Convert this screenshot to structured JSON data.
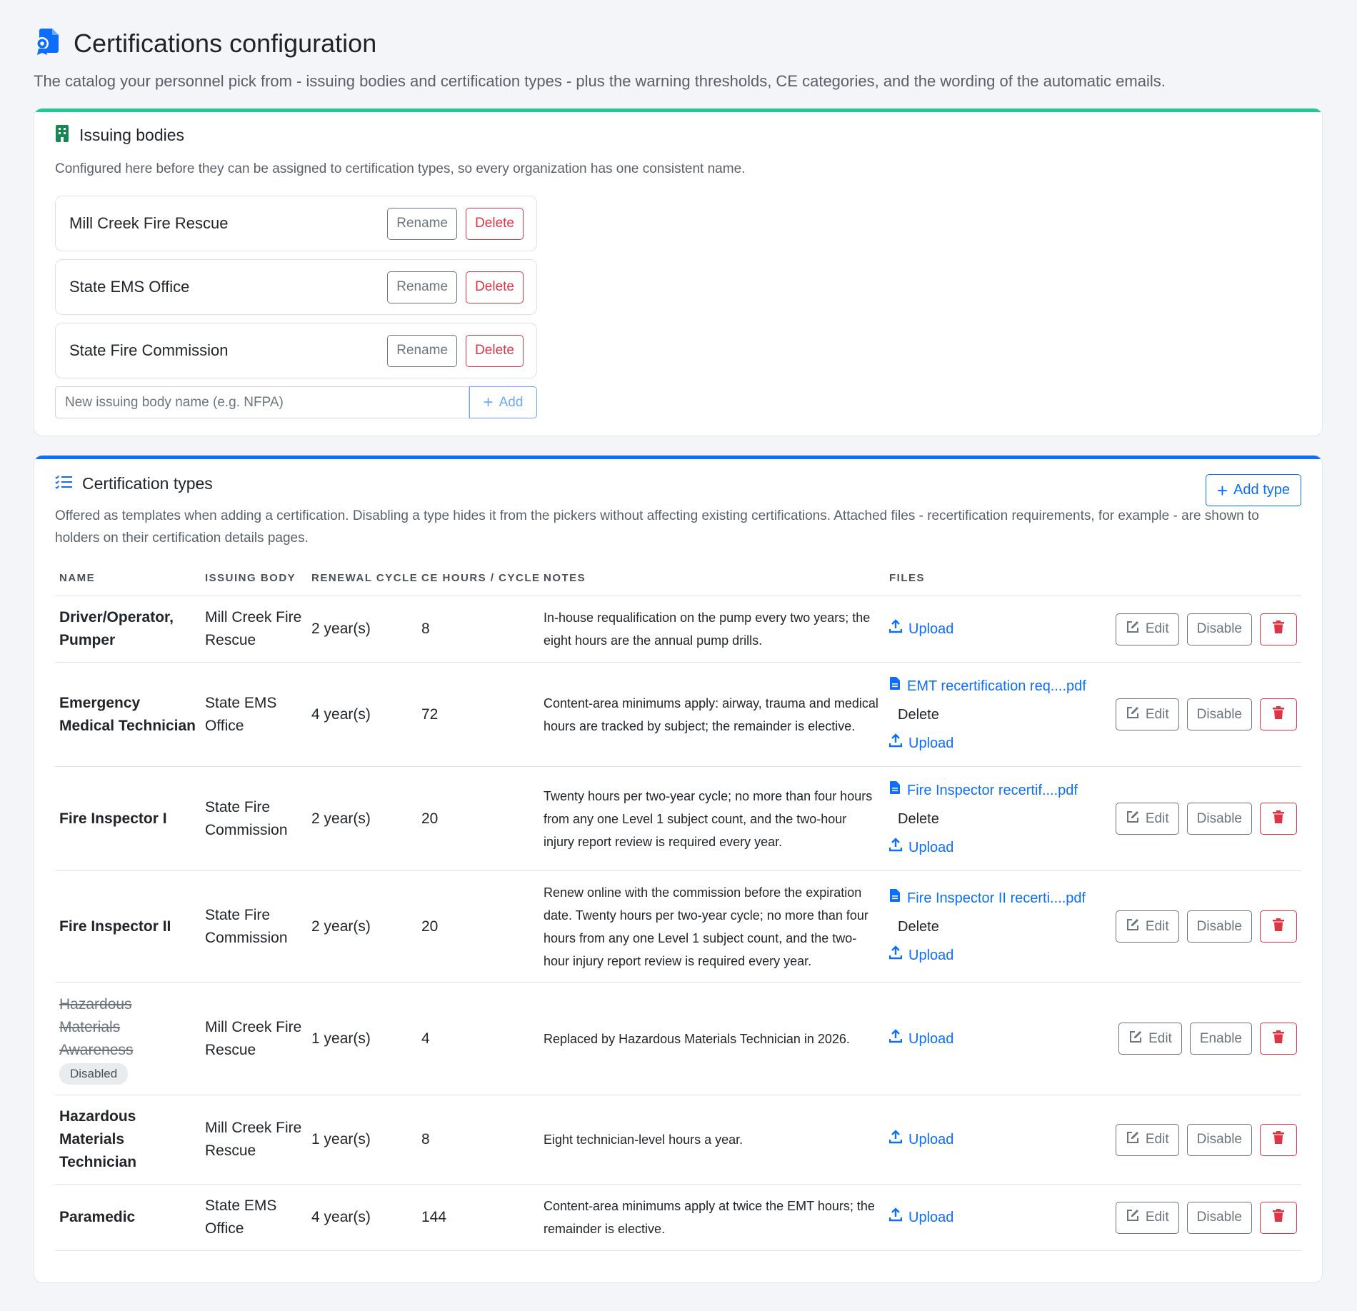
{
  "header": {
    "title": "Certifications configuration",
    "subtitle": "The catalog your personnel pick from - issuing bodies and certification types - plus the warning thresholds, CE categories, and the wording of the automatic emails.",
    "icon": "certificate-icon"
  },
  "colors": {
    "accent_green": "#20c997",
    "accent_blue": "#0d6efd",
    "danger": "#dc3545",
    "secondary": "#6c757d"
  },
  "issuing_bodies": {
    "title": "Issuing bodies",
    "icon": "building-icon",
    "description": "Configured here before they can be assigned to certification types, so every organization has one consistent name.",
    "rename_label": "Rename",
    "delete_label": "Delete",
    "items": [
      {
        "name": "Mill Creek Fire Rescue"
      },
      {
        "name": "State EMS Office"
      },
      {
        "name": "State Fire Commission"
      }
    ],
    "new_input": {
      "value": "",
      "placeholder": "New issuing body name (e.g. NFPA)"
    },
    "add_label": "Add"
  },
  "certification_types": {
    "title": "Certification types",
    "icon": "list-check-icon",
    "add_type_label": "Add type",
    "description": "Offered as templates when adding a certification. Disabling a type hides it from the pickers without affecting existing certifications. Attached files - recertification requirements, for example - are shown to holders on their certification details pages.",
    "columns": [
      "NAME",
      "ISSUING BODY",
      "RENEWAL CYCLE",
      "CE HOURS / CYCLE",
      "NOTES",
      "FILES"
    ],
    "edit_label": "Edit",
    "disable_label": "Disable",
    "enable_label": "Enable",
    "upload_label": "Upload",
    "file_delete_label": "Delete",
    "disabled_badge": "Disabled",
    "rows": [
      {
        "name": "Driver/Operator, Pumper",
        "issuing_body": "Mill Creek Fire Rescue",
        "renewal": "2 year(s)",
        "ce_hours": "8",
        "notes": "In-house requalification on the pump every two years; the eight hours are the annual pump drills.",
        "file": "",
        "disabled": false
      },
      {
        "name": "Emergency Medical Technician",
        "issuing_body": "State EMS Office",
        "renewal": "4 year(s)",
        "ce_hours": "72",
        "notes": "Content-area minimums apply: airway, trauma and medical hours are tracked by subject; the remainder is elective.",
        "file": "EMT recertification req....pdf",
        "disabled": false
      },
      {
        "name": "Fire Inspector I",
        "issuing_body": "State Fire Commission",
        "renewal": "2 year(s)",
        "ce_hours": "20",
        "notes": "Twenty hours per two-year cycle; no more than four hours from any one Level 1 subject count, and the two-hour injury report review is required every year.",
        "file": "Fire Inspector recertif....pdf",
        "disabled": false
      },
      {
        "name": "Fire Inspector II",
        "issuing_body": "State Fire Commission",
        "renewal": "2 year(s)",
        "ce_hours": "20",
        "notes": "Renew online with the commission before the expiration date. Twenty hours per two-year cycle; no more than four hours from any one Level 1 subject count, and the two-hour injury report review is required every year.",
        "file": "Fire Inspector II recerti....pdf",
        "disabled": false
      },
      {
        "name": "Hazardous Materials Awareness",
        "issuing_body": "Mill Creek Fire Rescue",
        "renewal": "1 year(s)",
        "ce_hours": "4",
        "notes": "Replaced by Hazardous Materials Technician in 2026.",
        "file": "",
        "disabled": true
      },
      {
        "name": "Hazardous Materials Technician",
        "issuing_body": "Mill Creek Fire Rescue",
        "renewal": "1 year(s)",
        "ce_hours": "8",
        "notes": "Eight technician-level hours a year.",
        "file": "",
        "disabled": false
      },
      {
        "name": "Paramedic",
        "issuing_body": "State EMS Office",
        "renewal": "4 year(s)",
        "ce_hours": "144",
        "notes": "Content-area minimums apply at twice the EMT hours; the remainder is elective.",
        "file": "",
        "disabled": false
      }
    ]
  }
}
